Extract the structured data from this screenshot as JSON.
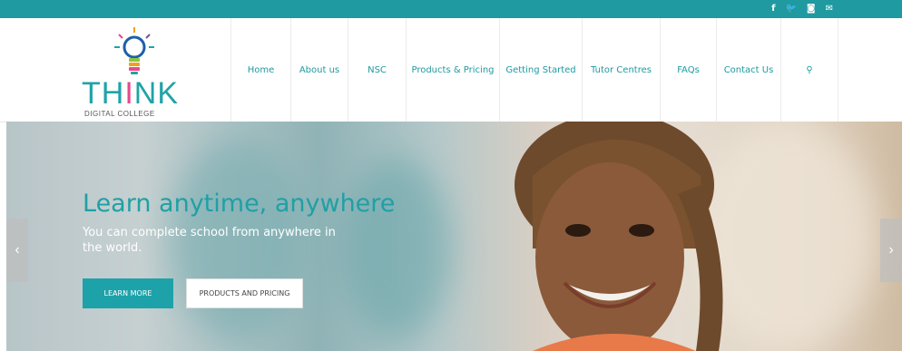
{
  "topbar": {
    "social": [
      {
        "icon": "facebook-icon",
        "glyph": "f"
      },
      {
        "icon": "twitter-icon",
        "glyph": "🐦"
      },
      {
        "icon": "instagram-icon",
        "glyph": "◙"
      },
      {
        "icon": "mail-icon",
        "glyph": "✉"
      }
    ]
  },
  "logo": {
    "word_start": "TH",
    "word_i": "I",
    "word_end": "NK",
    "tagline": "DIGITAL COLLEGE"
  },
  "nav": {
    "items": [
      {
        "label": "Home"
      },
      {
        "label": "About us"
      },
      {
        "label": "NSC"
      },
      {
        "label": "Products & Pricing"
      },
      {
        "label": "Getting Started"
      },
      {
        "label": "Tutor Centres"
      },
      {
        "label": "FAQs"
      },
      {
        "label": "Contact Us"
      }
    ],
    "search_glyph": "⚲"
  },
  "hero": {
    "title": "Learn anytime, anywhere",
    "subtitle": "You can complete school from anywhere in the world.",
    "learn_more": "LEARN MORE",
    "products_pricing": "PRODUCTS AND PRICING",
    "prev_glyph": "‹",
    "next_glyph": "›"
  },
  "colors": {
    "brand": "#1e9aa0",
    "accent": "#e64a8a"
  }
}
